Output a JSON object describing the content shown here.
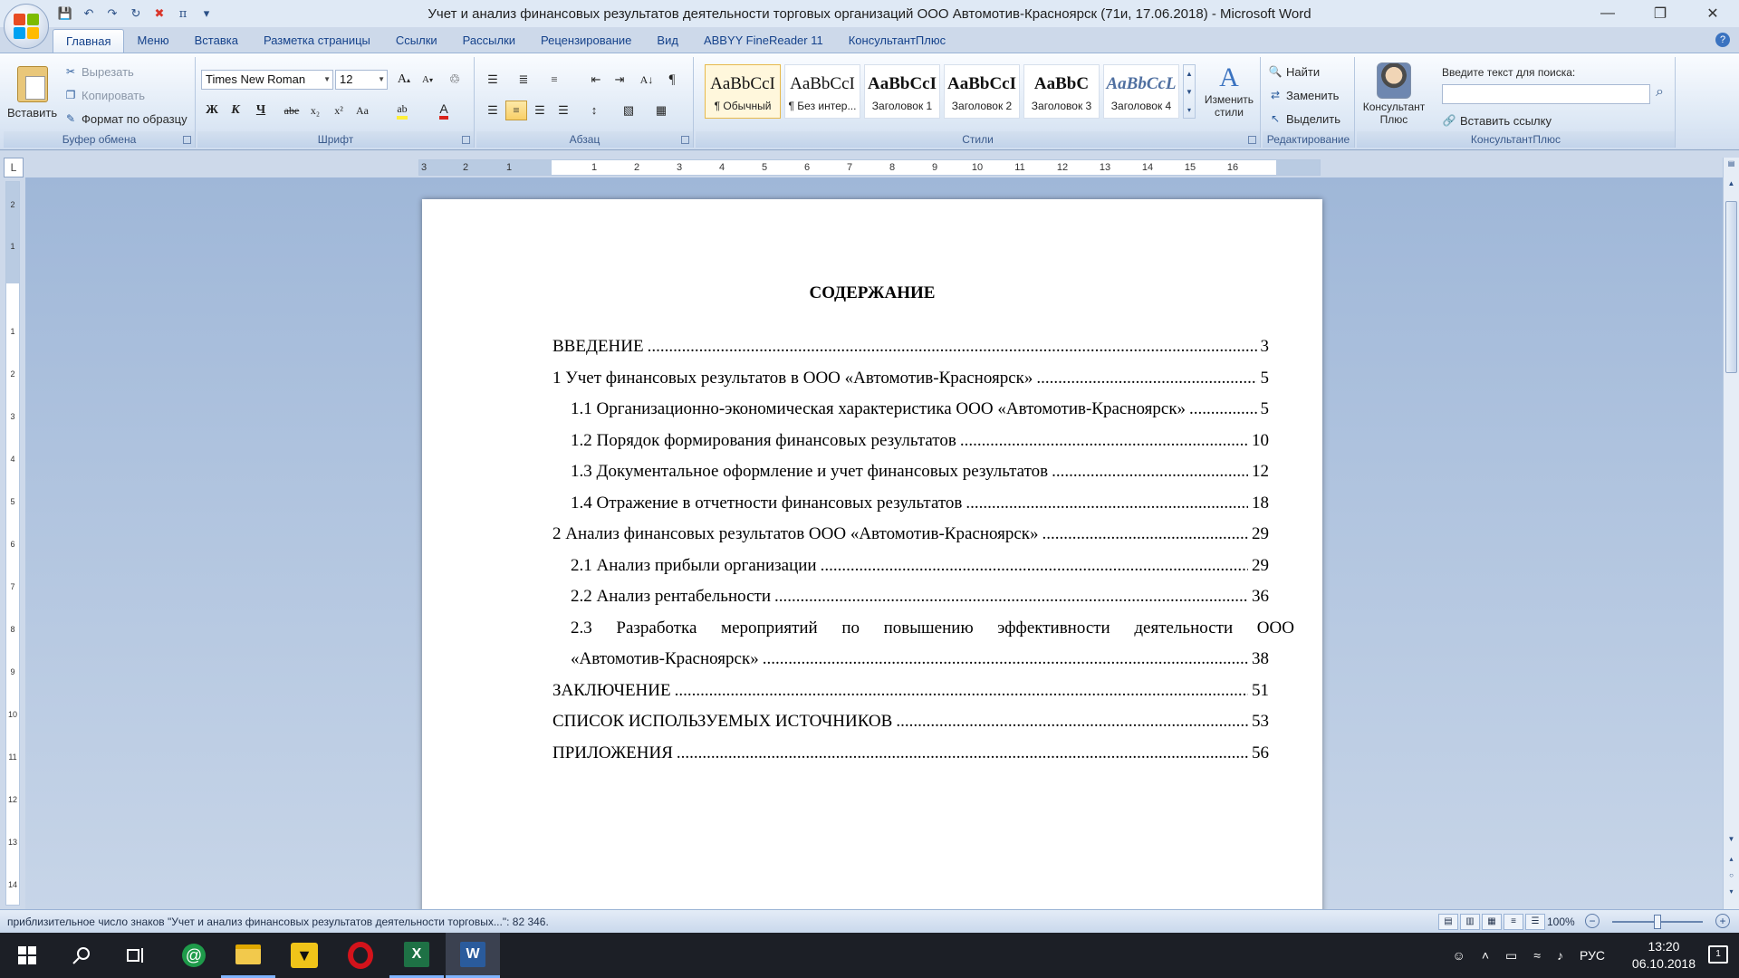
{
  "window": {
    "title": "Учет и анализ финансовых результатов деятельности торговых организаций ООО Автомотив-Красноярск (71и, 17.06.2018) - Microsoft Word",
    "controls": [
      "—",
      "❐",
      "✕"
    ]
  },
  "qat": [
    "save-icon",
    "undo-icon",
    "redo-icon",
    "repeat-icon",
    "close-icon",
    "pi-icon",
    "customize-icon"
  ],
  "tabs": [
    "Главная",
    "Меню",
    "Вставка",
    "Разметка страницы",
    "Ссылки",
    "Рассылки",
    "Рецензирование",
    "Вид",
    "ABBYY FineReader 11",
    "КонсультантПлюс"
  ],
  "ribbon": {
    "clipboard": {
      "label": "Буфер обмена",
      "paste": "Вставить",
      "cut": "Вырезать",
      "copy": "Копировать",
      "format_painter": "Формат по образцу"
    },
    "font": {
      "label": "Шрифт",
      "name": "Times New Roman",
      "size": "12",
      "bold": "Ж",
      "italic": "К",
      "underline": "Ч",
      "strike": "abe",
      "subscript": "x₂",
      "superscript": "x²",
      "case": "Aa",
      "grow": "A",
      "shrink": "A"
    },
    "paragraph": {
      "label": "Абзац"
    },
    "styles": {
      "label": "Стили",
      "items": [
        {
          "sample": "AaBbCcI",
          "name": "¶ Обычный"
        },
        {
          "sample": "AaBbCcI",
          "name": "¶ Без интер..."
        },
        {
          "sample": "AaBbCcI",
          "name": "Заголовок 1"
        },
        {
          "sample": "AaBbCcI",
          "name": "Заголовок 2"
        },
        {
          "sample": "AaBbC",
          "name": "Заголовок 3"
        },
        {
          "sample": "AaBbCcL",
          "name": "Заголовок 4"
        }
      ],
      "change": "Изменить стили"
    },
    "editing": {
      "label": "Редактирование",
      "find": "Найти",
      "replace": "Заменить",
      "select": "Выделить"
    },
    "consultant": {
      "label": "КонсультантПлюс",
      "button": "Консультант Плюс",
      "search_label": "Введите текст для поиска:",
      "insert_link": "Вставить ссылку"
    }
  },
  "ruler": {
    "h_ticks": [
      "3",
      "2",
      "1",
      "1",
      "2",
      "3",
      "4",
      "5",
      "6",
      "7",
      "8",
      "9",
      "10",
      "11",
      "12",
      "13",
      "14",
      "15",
      "16"
    ],
    "v_ticks": [
      "2",
      "1",
      "1",
      "2",
      "3",
      "4",
      "5",
      "6",
      "7",
      "8",
      "9",
      "10",
      "11",
      "12",
      "13",
      "14"
    ]
  },
  "document": {
    "title": "СОДЕРЖАНИЕ",
    "toc": [
      {
        "text": "ВВЕДЕНИЕ",
        "page": "3"
      },
      {
        "text": "1 Учет финансовых результатов в ООО «Автомотив-Красноярск»",
        "page": "5"
      },
      {
        "text": "1.1 Организационно-экономическая характеристика ООО «Автомотив-Красноярск»",
        "page": "5"
      },
      {
        "text": "1.2 Порядок формирования финансовых результатов",
        "page": "10"
      },
      {
        "text": "1.3 Документальное оформление и учет финансовых результатов",
        "page": "12"
      },
      {
        "text": "1.4 Отражение в отчетности финансовых результатов",
        "page": "18"
      },
      {
        "text": "2 Анализ финансовых результатов ООО «Автомотив-Красноярск»",
        "page": "29"
      },
      {
        "text": "2.1 Анализ прибыли организации",
        "page": "29"
      },
      {
        "text": "2.2 Анализ рентабельности",
        "page": "36"
      },
      {
        "text": "«Автомотив-Красноярск»",
        "page": "38"
      },
      {
        "text": "ЗАКЛЮЧЕНИЕ",
        "page": "51"
      },
      {
        "text": "СПИСОК ИСПОЛЬЗУЕМЫХ ИСТОЧНИКОВ",
        "page": "53"
      },
      {
        "text": "ПРИЛОЖЕНИЯ",
        "page": "56"
      }
    ],
    "justified_line": [
      "2.3",
      "Разработка",
      "мероприятий",
      "по",
      "повышению",
      "эффективности",
      "деятельности",
      "ООО"
    ]
  },
  "status": {
    "text": "приблизительное число знаков \"Учет и анализ финансовых результатов деятельности торговых...\": 82 346.",
    "zoom": "100%"
  },
  "taskbar": {
    "lang": "РУС",
    "time": "13:20",
    "date": "06.10.2018",
    "notifications": "1"
  },
  "colors": {
    "word_blue": "#2a5b9c",
    "excel_green": "#1e7145",
    "opera_red": "#d3131b"
  }
}
